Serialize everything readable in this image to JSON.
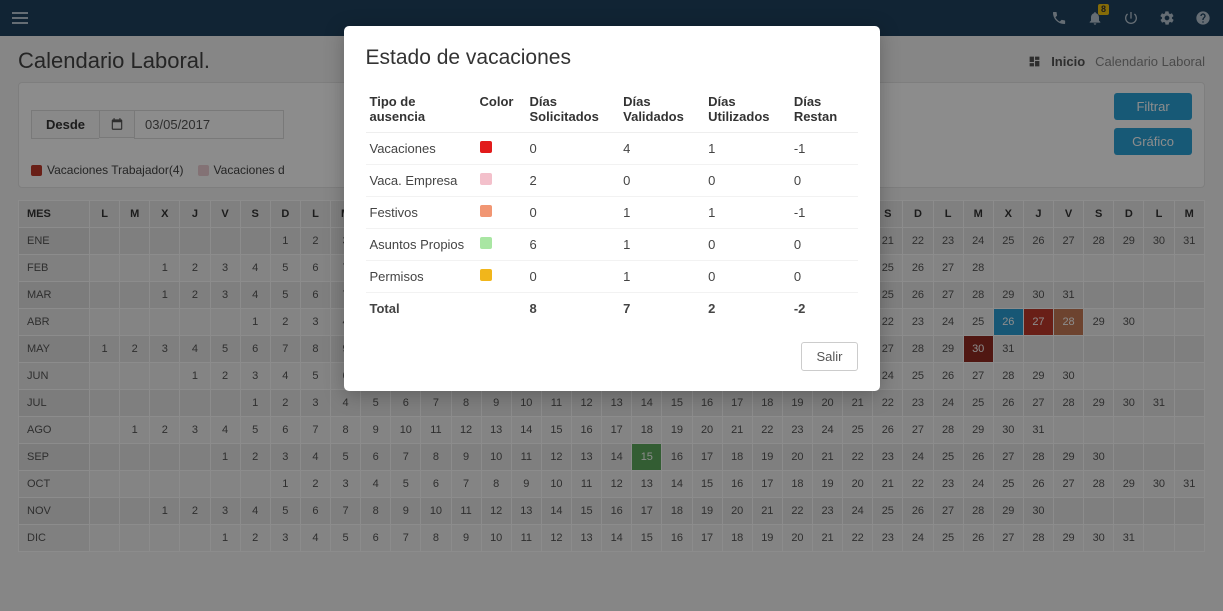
{
  "nav": {
    "notification_badge": "8"
  },
  "header": {
    "title": "Calendario Laboral.",
    "bc_home": "Inicio",
    "bc_page": "Calendario Laboral"
  },
  "filter": {
    "label": "Desde",
    "date_value": "03/05/2017",
    "btn_filter": "Filtrar",
    "btn_chart": "Gráfico"
  },
  "legend": {
    "items": [
      {
        "label": "Vacaciones Trabajador(4)",
        "color": "#c03a2a"
      },
      {
        "label": "Vacaciones d",
        "color": "#eecfd6"
      }
    ]
  },
  "calendar": {
    "month_header": "MES",
    "day_headers": [
      "L",
      "M",
      "X",
      "J",
      "V",
      "S",
      "D",
      "L",
      "M",
      "X",
      "J",
      "V",
      "S",
      "D",
      "L",
      "M",
      "X",
      "J",
      "V",
      "S",
      "D",
      "L",
      "M",
      "X",
      "J",
      "V",
      "S",
      "D",
      "L",
      "M",
      "X",
      "J",
      "V",
      "S",
      "D",
      "L",
      "M"
    ],
    "rows": [
      {
        "month": "ENE",
        "start": 6,
        "days": 31,
        "highlights": {}
      },
      {
        "month": "FEB",
        "start": 2,
        "days": 28,
        "highlights": {}
      },
      {
        "month": "MAR",
        "start": 2,
        "days": 31,
        "highlights": {}
      },
      {
        "month": "ABR",
        "start": 5,
        "days": 30,
        "highlights": {
          "18": "darkred",
          "20": "red",
          "21": "red",
          "26": "blue",
          "27": "red",
          "28": "orange"
        }
      },
      {
        "month": "MAY",
        "start": 0,
        "days": 31,
        "highlights": {
          "30": "darkred2"
        }
      },
      {
        "month": "JUN",
        "start": 3,
        "days": 30,
        "highlights": {}
      },
      {
        "month": "JUL",
        "start": 5,
        "days": 31,
        "highlights": {}
      },
      {
        "month": "AGO",
        "start": 1,
        "days": 31,
        "highlights": {}
      },
      {
        "month": "SEP",
        "start": 4,
        "days": 30,
        "highlights": {
          "15": "green"
        }
      },
      {
        "month": "OCT",
        "start": 6,
        "days": 31,
        "highlights": {}
      },
      {
        "month": "NOV",
        "start": 2,
        "days": 30,
        "highlights": {}
      },
      {
        "month": "DIC",
        "start": 4,
        "days": 31,
        "highlights": {}
      }
    ]
  },
  "modal": {
    "title": "Estado de vacaciones",
    "columns": [
      "Tipo de ausencia",
      "Color",
      "Días Solicitados",
      "Días Validados",
      "Días Utilizados",
      "Días Restan"
    ],
    "rows": [
      {
        "tipo": "Vacaciones",
        "color": "#e21b1b",
        "solicitados": "0",
        "validados": "4",
        "utilizados": "1",
        "restan": "-1"
      },
      {
        "tipo": "Vaca. Empresa",
        "color": "#f3c0cb",
        "solicitados": "2",
        "validados": "0",
        "utilizados": "0",
        "restan": "0"
      },
      {
        "tipo": "Festivos",
        "color": "#f19673",
        "solicitados": "0",
        "validados": "1",
        "utilizados": "1",
        "restan": "-1"
      },
      {
        "tipo": "Asuntos Propios",
        "color": "#a9e6a3",
        "solicitados": "6",
        "validados": "1",
        "utilizados": "0",
        "restan": "0"
      },
      {
        "tipo": "Permisos",
        "color": "#f1b61b",
        "solicitados": "0",
        "validados": "1",
        "utilizados": "0",
        "restan": "0"
      }
    ],
    "total_label": "Total",
    "totals": {
      "solicitados": "8",
      "validados": "7",
      "utilizados": "2",
      "restan": "-2"
    },
    "btn_exit": "Salir"
  }
}
